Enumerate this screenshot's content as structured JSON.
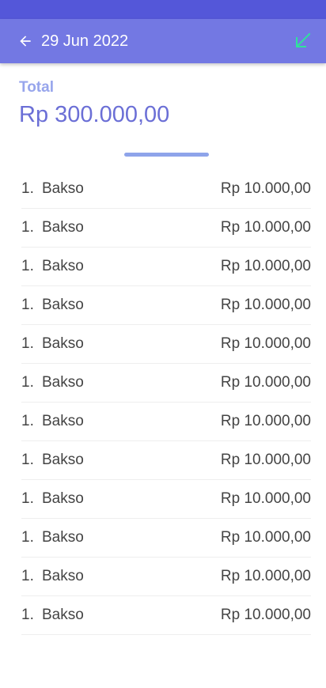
{
  "header": {
    "title": "29 Jun 2022",
    "back_icon": "arrow-left-icon",
    "action_icon": "arrow-down-left-icon",
    "colors": {
      "status_bar": "#5457d9",
      "app_bar": "#7378e3",
      "action_icon": "#2fe39b"
    }
  },
  "summary": {
    "total_label": "Total",
    "total_value": "Rp 300.000,00"
  },
  "items": [
    {
      "qty": "1.",
      "name": "Bakso",
      "price": "Rp 10.000,00"
    },
    {
      "qty": "1.",
      "name": "Bakso",
      "price": "Rp 10.000,00"
    },
    {
      "qty": "1.",
      "name": "Bakso",
      "price": "Rp 10.000,00"
    },
    {
      "qty": "1.",
      "name": "Bakso",
      "price": "Rp 10.000,00"
    },
    {
      "qty": "1.",
      "name": "Bakso",
      "price": "Rp 10.000,00"
    },
    {
      "qty": "1.",
      "name": "Bakso",
      "price": "Rp 10.000,00"
    },
    {
      "qty": "1.",
      "name": "Bakso",
      "price": "Rp 10.000,00"
    },
    {
      "qty": "1.",
      "name": "Bakso",
      "price": "Rp 10.000,00"
    },
    {
      "qty": "1.",
      "name": "Bakso",
      "price": "Rp 10.000,00"
    },
    {
      "qty": "1.",
      "name": "Bakso",
      "price": "Rp 10.000,00"
    },
    {
      "qty": "1.",
      "name": "Bakso",
      "price": "Rp 10.000,00"
    },
    {
      "qty": "1.",
      "name": "Bakso",
      "price": "Rp 10.000,00"
    }
  ]
}
